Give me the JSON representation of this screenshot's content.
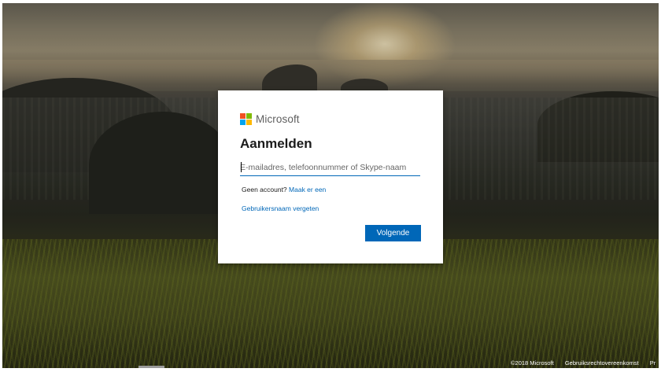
{
  "brand": {
    "name": "Microsoft",
    "logo_colors": [
      "#f25022",
      "#7fba00",
      "#00a4ef",
      "#ffb900"
    ]
  },
  "signin": {
    "title": "Aanmelden",
    "input_placeholder": "E-mailadres, telefoonnummer of Skype-naam",
    "input_value": "",
    "no_account_text": "Geen account?",
    "create_link": "Maak er een",
    "forgot_link": "Gebruikersnaam vergeten",
    "next_button": "Volgende"
  },
  "footer": {
    "copyright": "©2018 Microsoft",
    "terms": "Gebruiksrechtovereenkomst",
    "privacy": "Pr"
  },
  "colors": {
    "accent": "#0067b8",
    "card": "#ffffff",
    "text": "#1b1b1b"
  }
}
